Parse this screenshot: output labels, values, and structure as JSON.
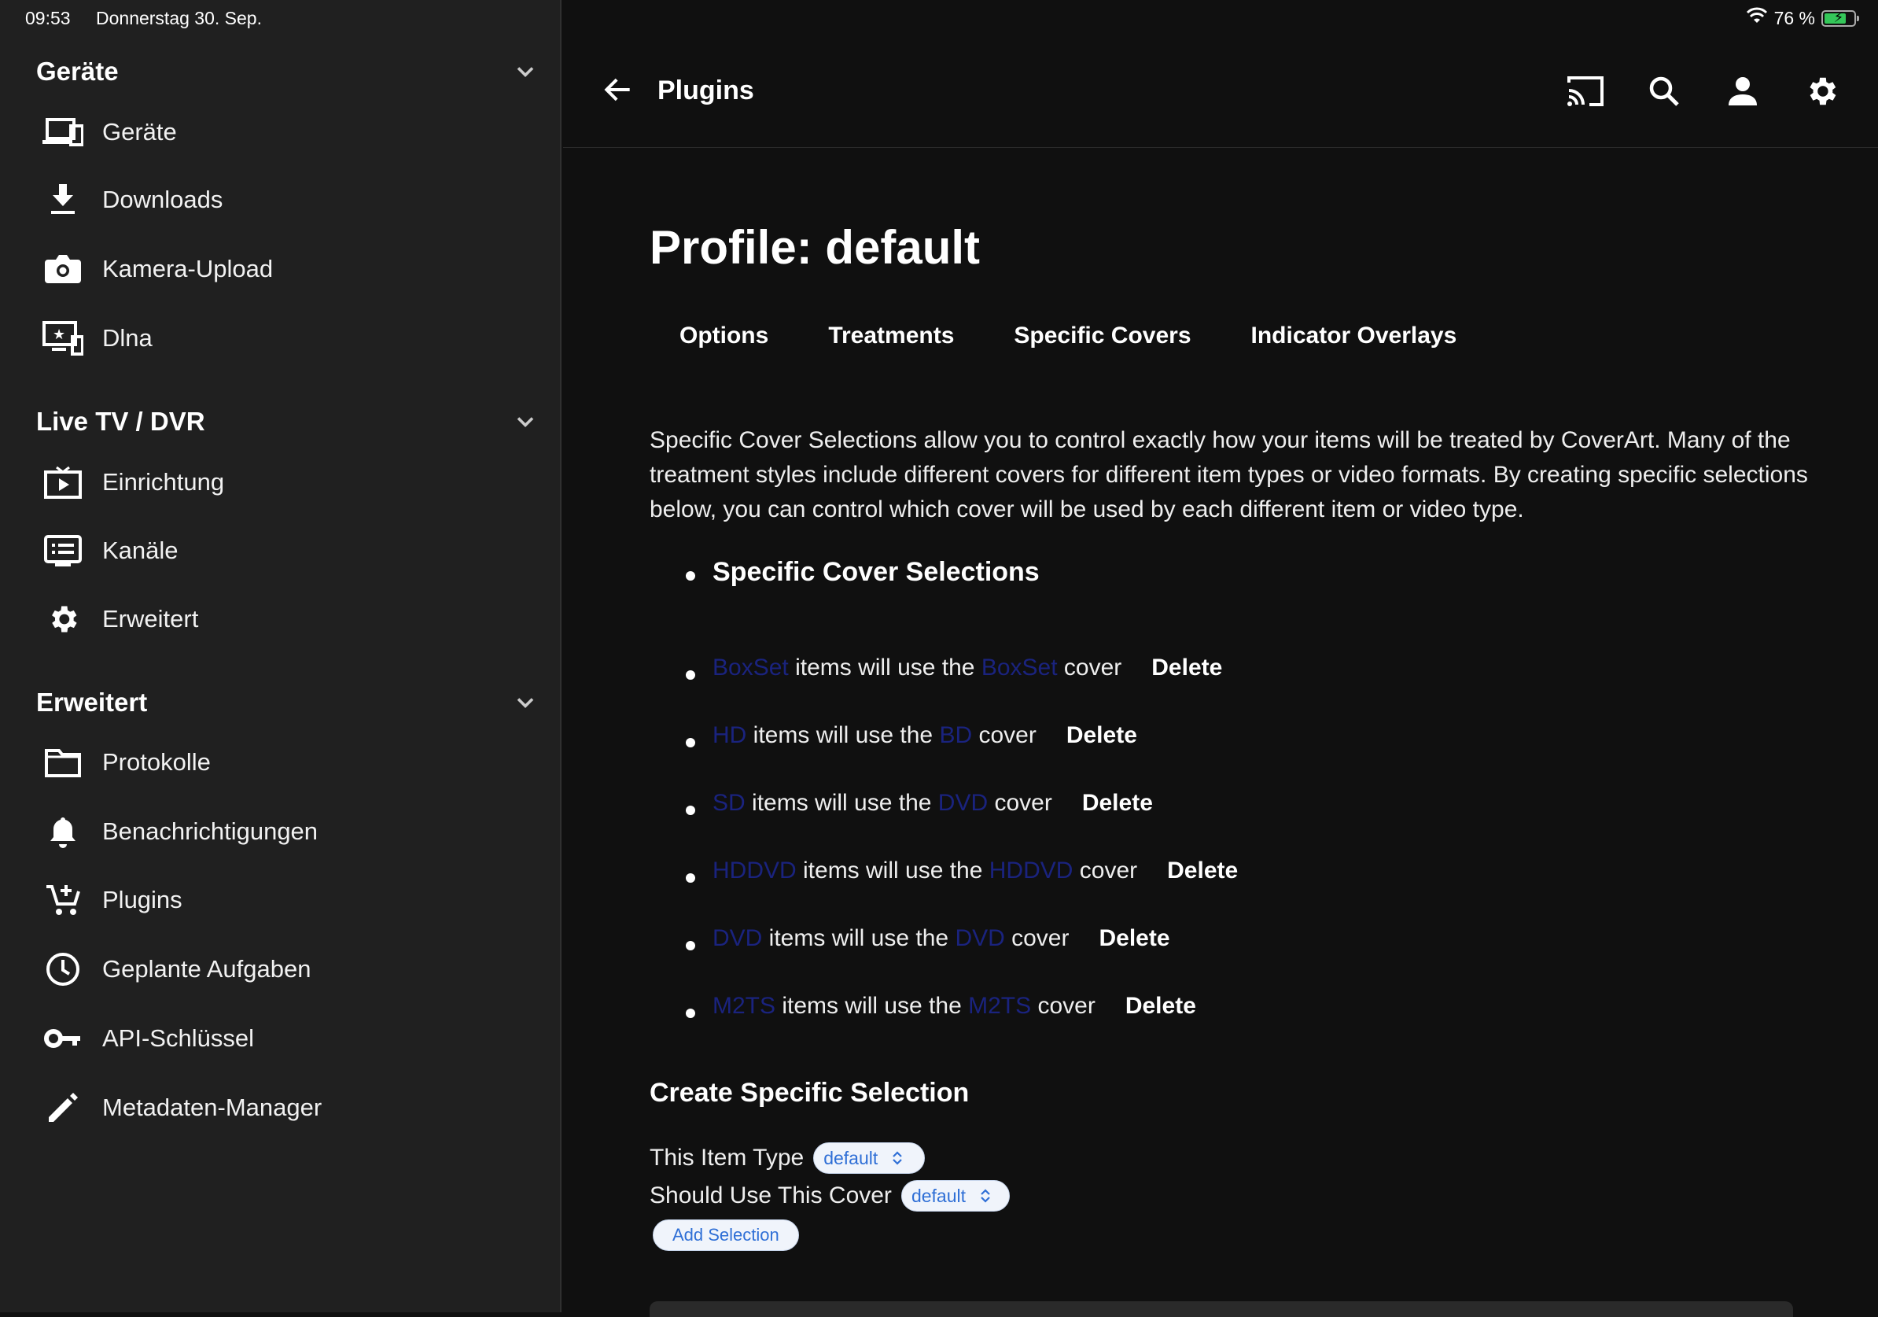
{
  "status": {
    "time": "09:53",
    "date": "Donnerstag 30. Sep.",
    "battery": "76 %"
  },
  "sidebar": {
    "sections": [
      {
        "title": "Geräte",
        "items": [
          {
            "label": "Geräte",
            "icon": "devices-icon"
          },
          {
            "label": "Downloads",
            "icon": "download-icon"
          },
          {
            "label": "Kamera-Upload",
            "icon": "camera-icon"
          },
          {
            "label": "Dlna",
            "icon": "dlna-icon"
          }
        ]
      },
      {
        "title": "Live TV / DVR",
        "items": [
          {
            "label": "Einrichtung",
            "icon": "tv-icon"
          },
          {
            "label": "Kanäle",
            "icon": "channels-icon"
          },
          {
            "label": "Erweitert",
            "icon": "gear-icon"
          }
        ]
      },
      {
        "title": "Erweitert",
        "items": [
          {
            "label": "Protokolle",
            "icon": "folder-icon"
          },
          {
            "label": "Benachrichtigungen",
            "icon": "bell-icon"
          },
          {
            "label": "Plugins",
            "icon": "cart-icon"
          },
          {
            "label": "Geplante Aufgaben",
            "icon": "clock-icon"
          },
          {
            "label": "API-Schlüssel",
            "icon": "key-icon"
          },
          {
            "label": "Metadaten-Manager",
            "icon": "pencil-icon"
          }
        ]
      }
    ]
  },
  "header": {
    "title": "Plugins"
  },
  "main": {
    "profile_title": "Profile: default",
    "tabs": [
      "Options",
      "Treatments",
      "Specific Covers",
      "Indicator Overlays"
    ],
    "description": "Specific Cover Selections allow you to control exactly how your items will be treated by CoverArt. Many of the treatment styles include different covers for different item types or video formats. By creating specific selections below, you can control which cover will be used by each different item or video type.",
    "selections_heading": "Specific Cover Selections",
    "rule_mid": " items will use the ",
    "rule_end": " cover",
    "delete_label": "Delete",
    "rules": [
      {
        "item": "BoxSet",
        "cover": "BoxSet"
      },
      {
        "item": "HD",
        "cover": "BD"
      },
      {
        "item": "SD",
        "cover": "DVD"
      },
      {
        "item": "HDDVD",
        "cover": "HDDVD"
      },
      {
        "item": "DVD",
        "cover": "DVD"
      },
      {
        "item": "M2TS",
        "cover": "M2TS"
      }
    ],
    "create_title": "Create Specific Selection",
    "item_type_label": "This Item Type",
    "item_type_value": "default",
    "cover_label": "Should Use This Cover",
    "cover_value": "default",
    "add_button": "Add Selection"
  }
}
